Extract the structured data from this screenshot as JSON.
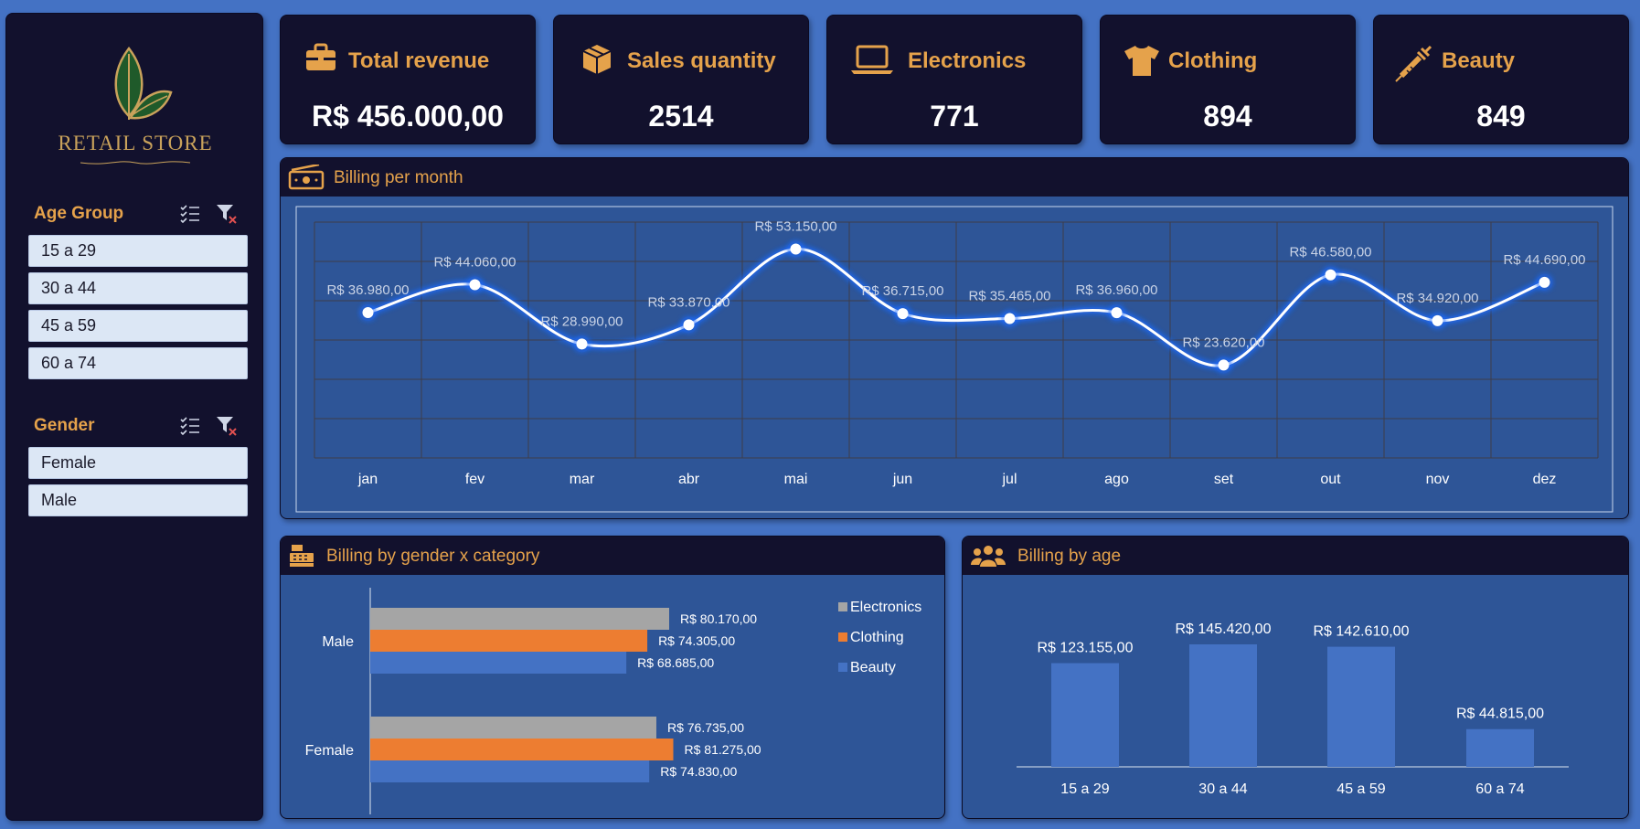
{
  "brand": {
    "name": "RETAIL STORE"
  },
  "filters": {
    "age_group": {
      "title": "Age Group",
      "items": [
        "15 a 29",
        "30 a 44",
        "45 a 59",
        "60 a 74"
      ]
    },
    "gender": {
      "title": "Gender",
      "items": [
        "Female",
        "Male"
      ]
    }
  },
  "kpis": [
    {
      "title": "Total revenue",
      "value": "R$ 456.000,00",
      "icon": "briefcase-icon"
    },
    {
      "title": "Sales quantity",
      "value": "2514",
      "icon": "box-icon"
    },
    {
      "title": "Electronics",
      "value": "771",
      "icon": "laptop-icon"
    },
    {
      "title": "Clothing",
      "value": "894",
      "icon": "shirt-icon"
    },
    {
      "title": "Beauty",
      "value": "849",
      "icon": "syringe-icon"
    }
  ],
  "colors": {
    "background": "#4472c4",
    "panel": "#12112d",
    "accent": "#e5a24b",
    "electronics": "#a5a5a5",
    "clothing": "#ed7d31",
    "beauty": "#4472c4"
  },
  "chart_data": [
    {
      "type": "line",
      "title": "Billing per month",
      "categories": [
        "jan",
        "fev",
        "mar",
        "abr",
        "mai",
        "jun",
        "jul",
        "ago",
        "set",
        "out",
        "nov",
        "dez"
      ],
      "values": [
        36980,
        44060,
        28990,
        33870,
        53150,
        36715,
        35465,
        36960,
        23620,
        46580,
        34920,
        44690
      ],
      "labels": [
        "R$ 36.980,00",
        "R$ 44.060,00",
        "R$ 28.990,00",
        "R$ 33.870,00",
        "R$ 53.150,00",
        "R$ 36.715,00",
        "R$ 35.465,00",
        "R$ 36.960,00",
        "R$ 23.620,00",
        "R$ 46.580,00",
        "R$ 34.920,00",
        "R$ 44.690,00"
      ],
      "ylim": [
        0,
        60000
      ],
      "grid": true
    },
    {
      "type": "bar",
      "orientation": "horizontal",
      "title": "Billing by gender x category",
      "categories": [
        "Male",
        "Female"
      ],
      "series": [
        {
          "name": "Electronics",
          "values": [
            80170,
            76735
          ],
          "labels": [
            "R$ 80.170,00",
            "R$ 76.735,00"
          ]
        },
        {
          "name": "Clothing",
          "values": [
            74305,
            81275
          ],
          "labels": [
            "R$ 74.305,00",
            "R$ 81.275,00"
          ]
        },
        {
          "name": "Beauty",
          "values": [
            68685,
            74830
          ],
          "labels": [
            "R$ 68.685,00",
            "R$ 74.830,00"
          ]
        }
      ],
      "legend": "right"
    },
    {
      "type": "bar",
      "title": "Billing by age",
      "categories": [
        "15 a 29",
        "30 a 44",
        "45 a 59",
        "60 a 74"
      ],
      "values": [
        123155,
        145420,
        142610,
        44815
      ],
      "labels": [
        "R$ 123.155,00",
        "R$ 145.420,00",
        "R$ 142.610,00",
        "R$ 44.815,00"
      ]
    }
  ]
}
